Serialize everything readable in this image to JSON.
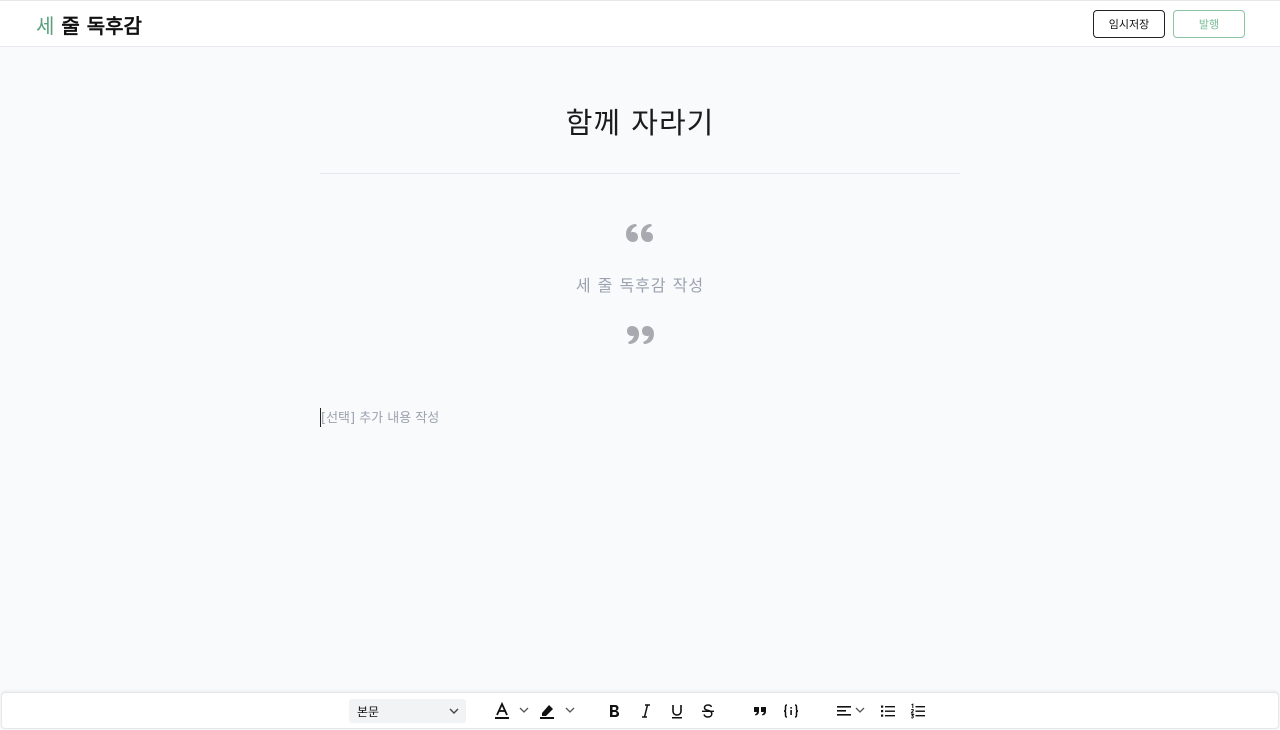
{
  "header": {
    "logo_accent": "세",
    "logo_rest": " 줄 독후감",
    "save_label": "임시저장",
    "publish_label": "발행"
  },
  "editor": {
    "title": "함께 자라기",
    "review_placeholder": "세 줄 독후감 작성",
    "extra_placeholder": "[선택] 추가 내용 작성"
  },
  "toolbar": {
    "text_style": "본문",
    "icons": [
      "text-color-icon",
      "highlight-icon",
      "bold-icon",
      "italic-icon",
      "underline-icon",
      "strikethrough-icon",
      "blockquote-icon",
      "code-block-icon",
      "align-left-icon",
      "bullet-list-icon",
      "ordered-list-icon"
    ]
  },
  "colors": {
    "accent": "#5a9e7a",
    "publish_border": "#8cc6a3",
    "placeholder": "#9ca3af",
    "background": "#f8fafc"
  }
}
